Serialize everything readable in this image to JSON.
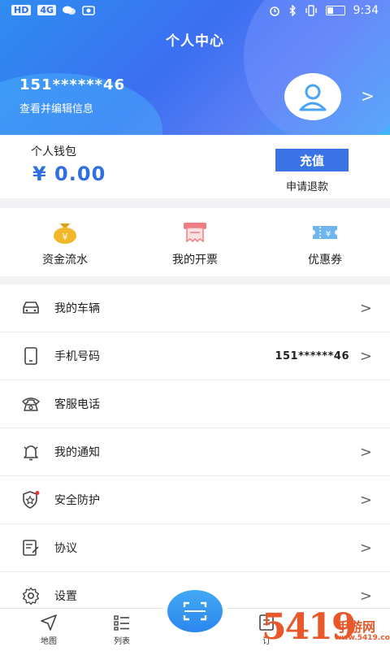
{
  "status_bar": {
    "network": "HD",
    "signal": "4G",
    "time": "9:34"
  },
  "header": {
    "title": "个人中心",
    "phone": "151******46",
    "edit_link": "查看并编辑信息",
    "chevron": ">"
  },
  "wallet": {
    "label": "个人钱包",
    "amount": "¥ 0.00",
    "recharge_label": "充值",
    "refund_label": "申请退款"
  },
  "quick_actions": [
    {
      "label": "资金流水",
      "icon": "money-bag-icon"
    },
    {
      "label": "我的开票",
      "icon": "invoice-icon"
    },
    {
      "label": "优惠券",
      "icon": "coupon-icon"
    }
  ],
  "menu": [
    {
      "label": "我的车辆",
      "icon": "car-icon",
      "value": "",
      "chevron": ">"
    },
    {
      "label": "手机号码",
      "icon": "phone-icon",
      "value": "151******46",
      "chevron": ">"
    },
    {
      "label": "客服电话",
      "icon": "telephone-icon",
      "value": "",
      "chevron": ""
    },
    {
      "label": "我的通知",
      "icon": "bell-icon",
      "value": "",
      "chevron": ">"
    },
    {
      "label": "安全防护",
      "icon": "shield-icon",
      "value": "",
      "chevron": ">"
    },
    {
      "label": "协议",
      "icon": "document-icon",
      "value": "",
      "chevron": ">"
    },
    {
      "label": "设置",
      "icon": "gear-icon",
      "value": "",
      "chevron": ">"
    }
  ],
  "tabbar": [
    {
      "label": "地图",
      "icon": "navigation-icon"
    },
    {
      "label": "列表",
      "icon": "list-icon"
    },
    {
      "label": "订",
      "icon": "order-icon"
    }
  ],
  "watermark": {
    "number": "5419",
    "text": "手游网",
    "url": "www.5419.com.cn"
  },
  "colors": {
    "accent": "#3a73e6",
    "amount": "#2f6fe0",
    "watermark": "#e8582a"
  }
}
